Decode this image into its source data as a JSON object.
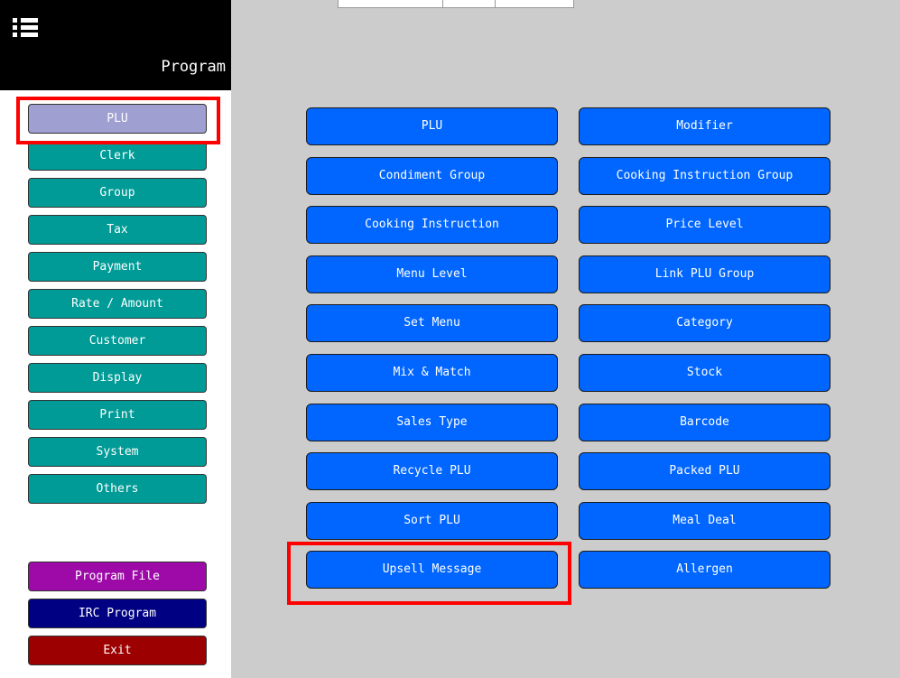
{
  "sidebar": {
    "title": "Program",
    "menu_icon": "list-menu-icon",
    "items": [
      {
        "label": "PLU",
        "state": "selected"
      },
      {
        "label": "Clerk"
      },
      {
        "label": "Group"
      },
      {
        "label": "Tax"
      },
      {
        "label": "Payment"
      },
      {
        "label": "Rate / Amount"
      },
      {
        "label": "Customer"
      },
      {
        "label": "Display"
      },
      {
        "label": "Print"
      },
      {
        "label": "System"
      },
      {
        "label": "Others"
      }
    ],
    "bottom": [
      {
        "label": "Program File"
      },
      {
        "label": "IRC Program"
      },
      {
        "label": "Exit"
      }
    ]
  },
  "main": {
    "left_column": [
      "PLU",
      "Condiment Group",
      "Cooking Instruction",
      "Menu Level",
      "Set Menu",
      "Mix & Match",
      "Sales Type",
      "Recycle PLU",
      "Sort PLU",
      "Upsell Message"
    ],
    "right_column": [
      "Modifier",
      "Cooking Instruction Group",
      "Price Level",
      "Link PLU Group",
      "Category",
      "Stock",
      "Barcode",
      "Packed PLU",
      "Meal Deal",
      "Allergen"
    ]
  },
  "colors": {
    "teal": "#009b96",
    "selected": "#9f9fd2",
    "blue_button": "#0066ff",
    "program_file": "#9d0aa8",
    "irc_program": "#000083",
    "exit": "#9c0000",
    "highlight": "#ff0000"
  }
}
